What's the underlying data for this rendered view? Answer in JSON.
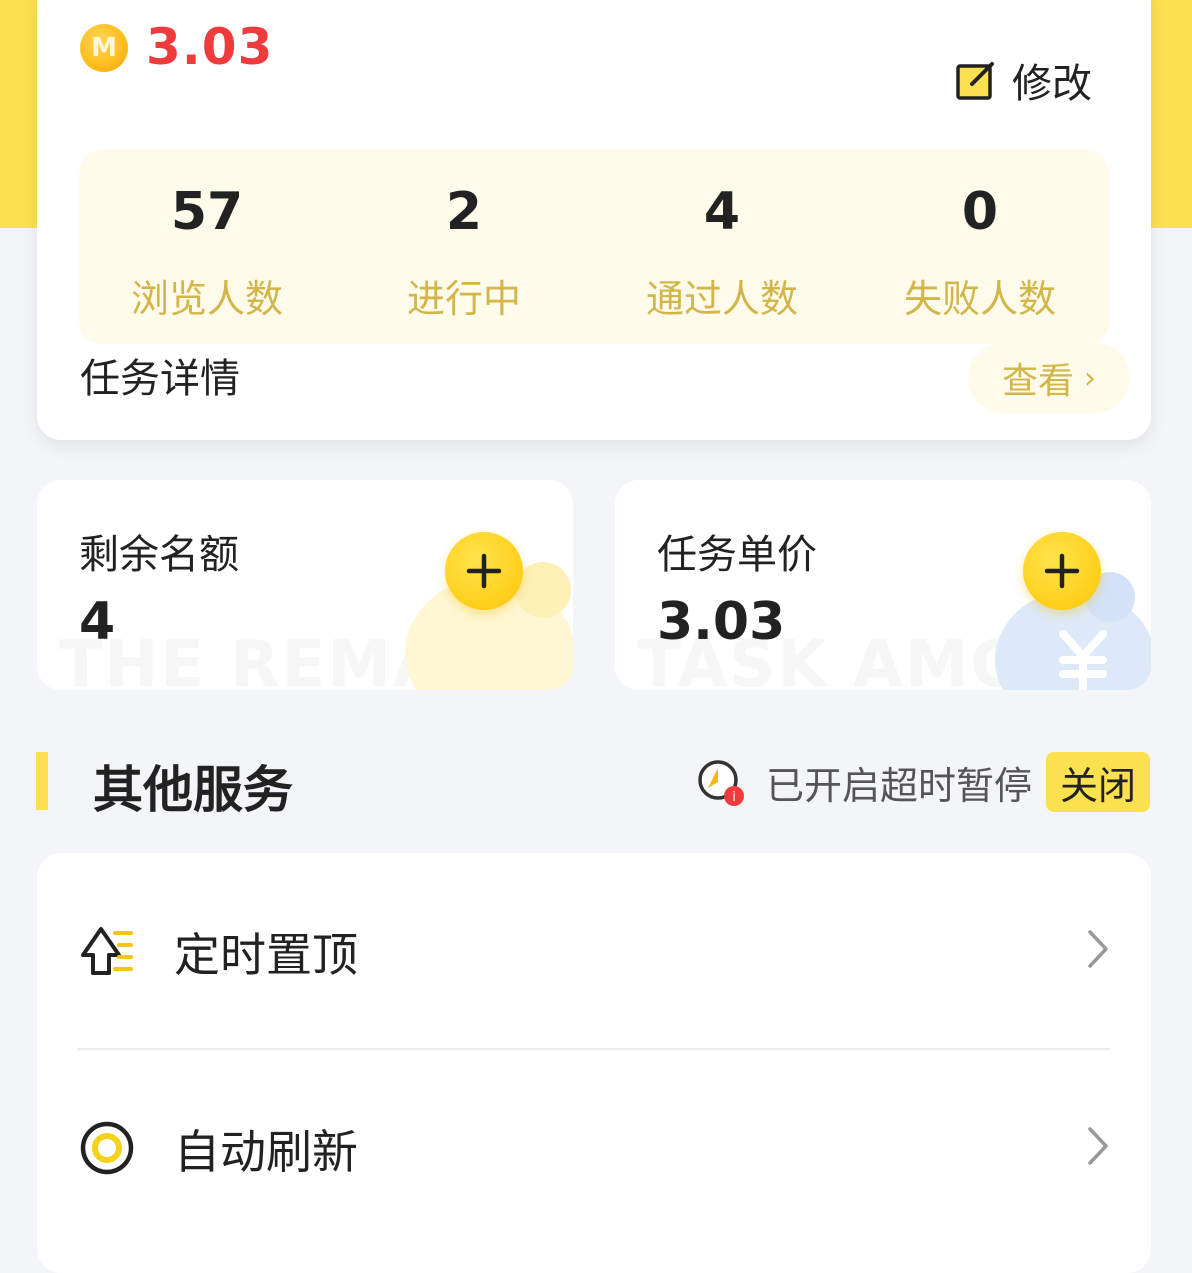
{
  "header": {
    "coin_glyph": "M",
    "amount": "3.03",
    "edit_label": "修改"
  },
  "stats": [
    {
      "value": "57",
      "label": "浏览人数"
    },
    {
      "value": "2",
      "label": "进行中"
    },
    {
      "value": "4",
      "label": "通过人数"
    },
    {
      "value": "0",
      "label": "失败人数"
    }
  ],
  "task_detail": {
    "title": "任务详情",
    "view_label": "查看",
    "chevron": "›"
  },
  "cards": {
    "remaining": {
      "title": "剩余名额",
      "value": "4",
      "watermark": "THE REMAIN"
    },
    "price": {
      "title": "任务单价",
      "value": "3.03",
      "watermark": "TASK AMOUN"
    }
  },
  "other_services": {
    "title": "其他服务",
    "timeout_text": "已开启超时暂停",
    "close_label": "关闭"
  },
  "services": [
    {
      "label": "定时置顶",
      "icon": "pin-top-icon"
    },
    {
      "label": "自动刷新",
      "icon": "refresh-circle-icon"
    }
  ],
  "colors": {
    "brand_yellow": "#fbe04f",
    "amount_red": "#ef3b3b",
    "label_gold": "#d3b64a"
  }
}
